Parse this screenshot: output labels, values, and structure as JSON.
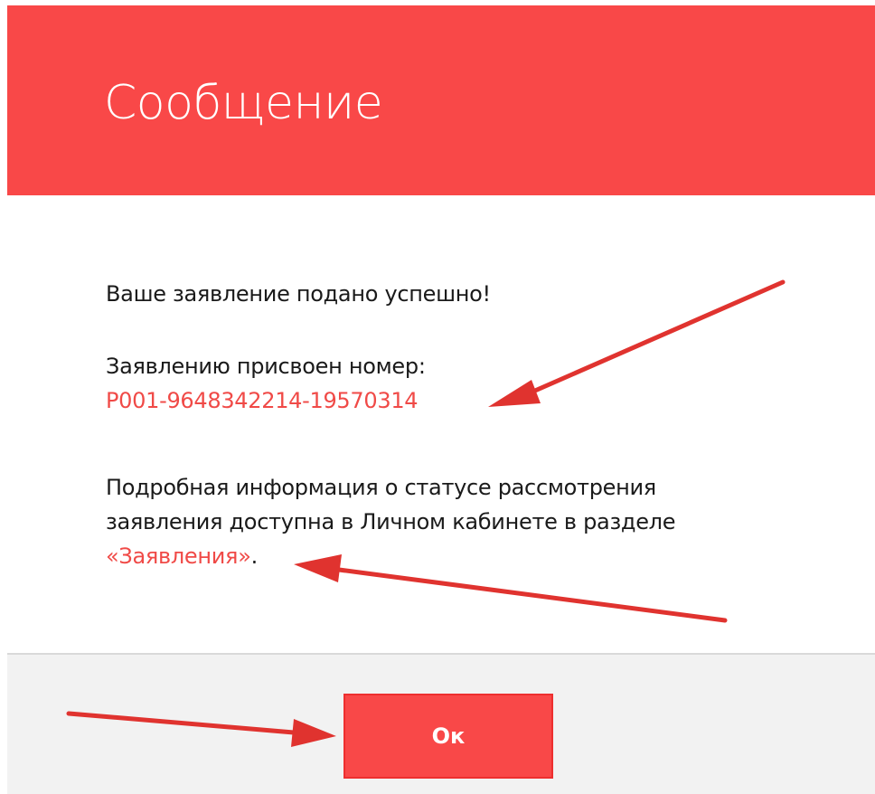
{
  "dialog": {
    "title": "Сообщение",
    "success_text": "Ваше заявление подано успешно!",
    "number_label": "Заявлению присвоен номер:",
    "application_number": "P001-9648342214-19570314",
    "info_line1": "Подробная информация о статусе рассмотрения",
    "info_line2": "заявления доступна в Личном кабинете в разделе",
    "section_link": "«Заявления»",
    "period": ".",
    "ok_label": "Ок"
  },
  "colors": {
    "accent": "#f94848",
    "link": "#f04a47",
    "annotation_arrow": "#e0332f",
    "footer_bg": "#f2f2f2"
  }
}
